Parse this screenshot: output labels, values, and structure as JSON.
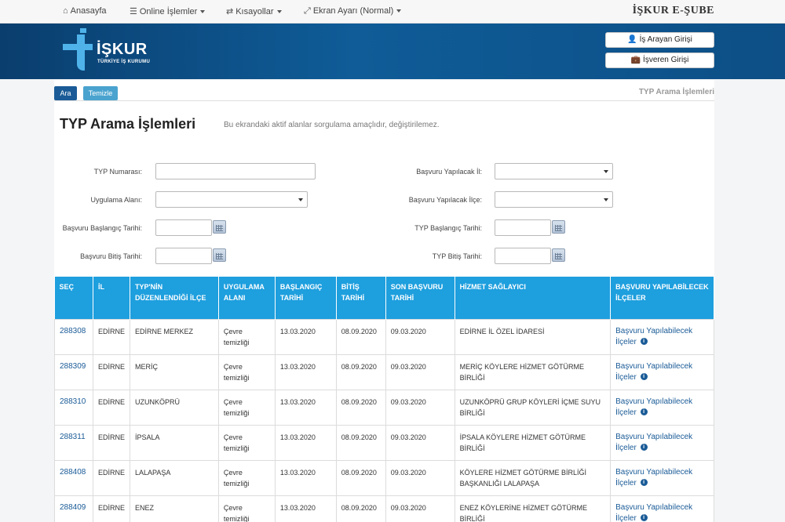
{
  "topnav": {
    "home": "Anasayfa",
    "online": "Online İşlemler",
    "shortcuts": "Kısayollar",
    "display": "Ekran Ayarı (Normal)",
    "brand": "İŞKUR E-ŞUBE"
  },
  "header": {
    "logo_name": "İŞKUR",
    "logo_sub": "TÜRKİYE İŞ KURUMU",
    "job_seeker_login": "İş Arayan Girişi",
    "employer_login": "İşveren Girişi"
  },
  "toolbar": {
    "search": "Ara",
    "clear": "Temizle",
    "breadcrumb": "TYP Arama İşlemleri"
  },
  "page": {
    "title": "TYP Arama İşlemleri",
    "subtitle": "Bu ekrandaki aktif alanlar sorgulama amaçlıdır, değiştirilemez."
  },
  "form": {
    "typ_no": "TYP Numarası:",
    "apply_province": "Başvuru Yapılacak İl:",
    "application_area": "Uygulama Alanı:",
    "apply_district": "Başvuru Yapılacak İlçe:",
    "apply_start": "Başvuru Başlangıç Tarihi:",
    "typ_start": "TYP Başlangıç Tarihi:",
    "apply_end": "Başvuru Bitiş Tarihi:",
    "typ_end": "TYP Bitiş Tarihi:"
  },
  "table": {
    "headers": [
      "SEÇ",
      "İL",
      "TYP'NİN DÜZENLENDİĞİ İLÇE",
      "UYGULAMA ALANI",
      "BAŞLANGIÇ TARİHİ",
      "BİTİŞ TARİHİ",
      "SON BAŞVURU TARİHİ",
      "HİZMET SAĞLAYICI",
      "BAŞVURU YAPILABİLECEK İLÇELER"
    ],
    "rows": [
      [
        "288308",
        "EDİRNE",
        "EDİRNE MERKEZ",
        "Çevre temizliği",
        "13.03.2020",
        "08.09.2020",
        "09.03.2020",
        "EDİRNE İL ÖZEL İDARESİ",
        "Başvuru Yapılabilecek İlçeler"
      ],
      [
        "288309",
        "EDİRNE",
        "MERİÇ",
        "Çevre temizliği",
        "13.03.2020",
        "08.09.2020",
        "09.03.2020",
        "MERİÇ KÖYLERE HİZMET GÖTÜRME BİRLİĞİ",
        "Başvuru Yapılabilecek İlçeler"
      ],
      [
        "288310",
        "EDİRNE",
        "UZUNKÖPRÜ",
        "Çevre temizliği",
        "13.03.2020",
        "08.09.2020",
        "09.03.2020",
        "UZUNKÖPRÜ GRUP KÖYLERİ İÇME SUYU BİRLİĞİ",
        "Başvuru Yapılabilecek İlçeler"
      ],
      [
        "288311",
        "EDİRNE",
        "İPSALA",
        "Çevre temizliği",
        "13.03.2020",
        "08.09.2020",
        "09.03.2020",
        "İPSALA KÖYLERE HİZMET GÖTÜRME BİRLİĞİ",
        "Başvuru Yapılabilecek İlçeler"
      ],
      [
        "288408",
        "EDİRNE",
        "LALAPAŞA",
        "Çevre temizliği",
        "13.03.2020",
        "08.09.2020",
        "09.03.2020",
        "KÖYLERE HİZMET GÖTÜRME BİRLİĞİ BAŞKANLIĞI LALAPAŞA",
        "Başvuru Yapılabilecek İlçeler"
      ],
      [
        "288409",
        "EDİRNE",
        "ENEZ",
        "Çevre temizliği",
        "13.03.2020",
        "08.09.2020",
        "09.03.2020",
        "ENEZ KÖYLERİNE HİZMET GÖTÜRME BİRLİĞİ",
        "Başvuru Yapılabilecek İlçeler"
      ]
    ]
  },
  "colors": {
    "header_dark": "#0a3e6e",
    "table_header": "#1e9fde",
    "link": "#1a5b97",
    "logo_accent": "#4fb3ea"
  }
}
